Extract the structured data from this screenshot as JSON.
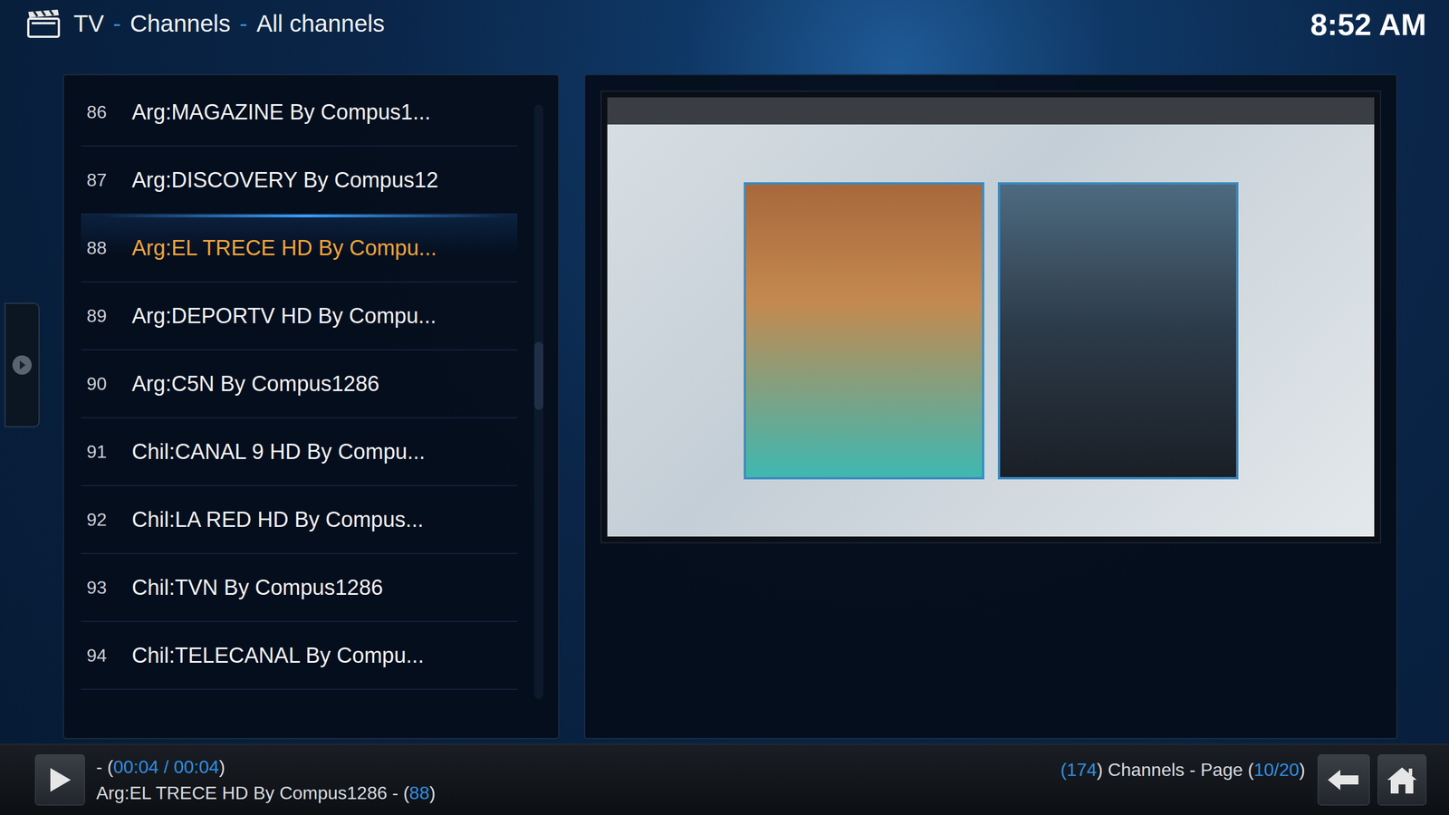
{
  "header": {
    "breadcrumb": [
      "TV",
      "Channels",
      "All channels"
    ],
    "separator": "-",
    "clock": "8:52 AM"
  },
  "channels": [
    {
      "number": "86",
      "name": "Arg:MAGAZINE By Compus1...",
      "selected": false
    },
    {
      "number": "87",
      "name": "Arg:DISCOVERY By Compus12",
      "selected": false
    },
    {
      "number": "88",
      "name": "Arg:EL TRECE HD By Compu...",
      "selected": true
    },
    {
      "number": "89",
      "name": "Arg:DEPORTV HD By Compu...",
      "selected": false
    },
    {
      "number": "90",
      "name": "Arg:C5N By Compus1286",
      "selected": false
    },
    {
      "number": "91",
      "name": "Chil:CANAL 9 HD By Compu...",
      "selected": false
    },
    {
      "number": "92",
      "name": "Chil:LA RED HD By Compus...",
      "selected": false
    },
    {
      "number": "93",
      "name": "Chil:TVN By Compus1286",
      "selected": false
    },
    {
      "number": "94",
      "name": "Chil:TELECANAL By Compu...",
      "selected": false
    }
  ],
  "scrollbar": {
    "level": 0.45
  },
  "now_playing": {
    "prefix": "- (",
    "elapsed": "00:04",
    "divider": " / ",
    "total": "00:04",
    "suffix": ")",
    "title": "Arg:EL TRECE HD By Compus1286",
    "title_joiner": " - (",
    "number": "88",
    "number_suffix": ")"
  },
  "footer": {
    "count_open": "(",
    "count": "174",
    "count_close": ") Channels - Page (",
    "page": "10/20",
    "page_close": ")"
  }
}
